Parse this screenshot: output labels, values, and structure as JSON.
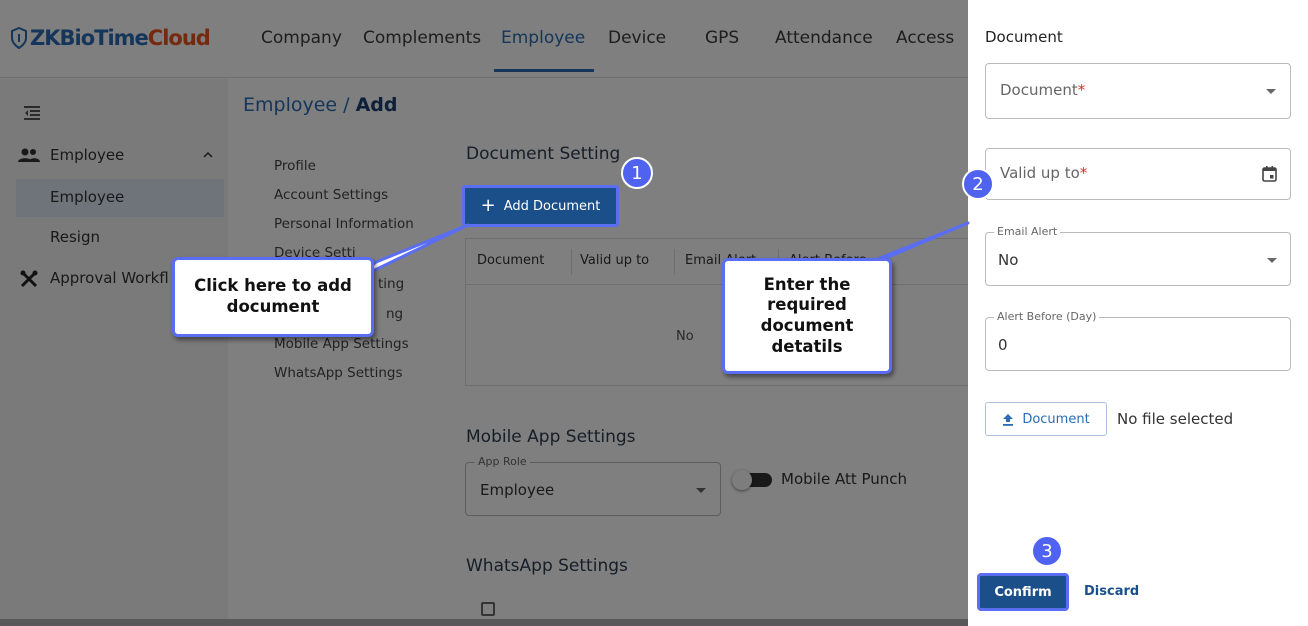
{
  "logo": {
    "brand": "ZKBioTime",
    "cloud": "Cloud"
  },
  "nav": [
    "Company",
    "Complements",
    "Employee",
    "Device",
    "GPS",
    "Attendance",
    "Access"
  ],
  "sidebar": {
    "items": [
      {
        "label": "Employee",
        "icon": "people-icon"
      },
      {
        "label": "Employee"
      },
      {
        "label": "Resign"
      },
      {
        "label": "Approval Workfl",
        "icon": "tools-icon"
      }
    ]
  },
  "breadcrumb": {
    "part1": "Employee",
    "sep": " / ",
    "part2": "Add"
  },
  "menu": [
    "Profile",
    "Account Settings",
    "Personal Information",
    "Device Setti",
    "ting",
    "ng",
    "Mobile App Settings",
    "WhatsApp Settings"
  ],
  "document_setting": {
    "title": "Document Setting",
    "add_button": "Add Document",
    "columns": [
      "Document",
      "Valid up to",
      "Email Alert",
      "Alert Before"
    ],
    "empty": "No"
  },
  "mobile_app": {
    "title": "Mobile App Settings",
    "role_label": "App Role",
    "role_value": "Employee",
    "punch_label": "Mobile Att Punch"
  },
  "whatsapp": {
    "title": "WhatsApp Settings"
  },
  "panel": {
    "title": "Document",
    "document_placeholder": "Document",
    "valid_placeholder": "Valid up to",
    "required_mark": "*",
    "email_alert_label": "Email Alert",
    "email_alert_value": "No",
    "alert_before_label": "Alert Before (Day)",
    "alert_before_value": "0",
    "upload_button": "Document",
    "no_file": "No file selected",
    "confirm": "Confirm",
    "discard": "Discard"
  },
  "annotations": {
    "step1": "1",
    "step2": "2",
    "step3": "3",
    "callout1_line1": "Click here to add",
    "callout1_line2": "document",
    "callout2_line1": "Enter the",
    "callout2_line2": "required",
    "callout2_line3": "document",
    "callout2_line4": "detatils"
  },
  "colors": {
    "accent": "#1b4f8a",
    "highlight": "#5b6ef2",
    "required": "#d32f2f"
  }
}
